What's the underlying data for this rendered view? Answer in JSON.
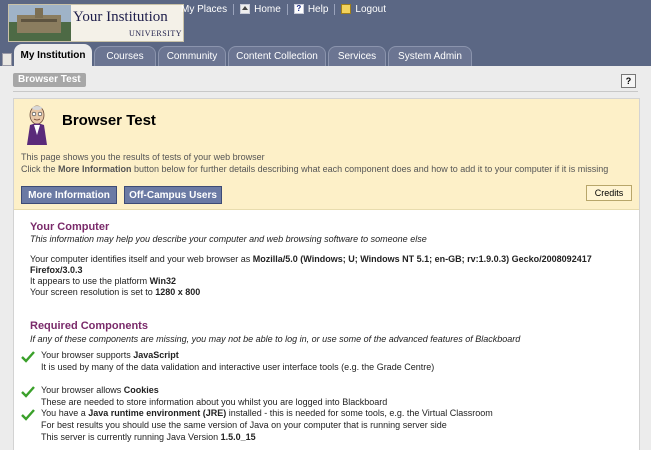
{
  "banner": {
    "institution_name": "Your Institution",
    "institution_sub": "UNIVERSITY"
  },
  "topnav": {
    "my_places": "My Places",
    "home": "Home",
    "help": "Help",
    "logout": "Logout"
  },
  "tabs": [
    {
      "label": "My Institution",
      "active": true
    },
    {
      "label": "Courses",
      "active": false
    },
    {
      "label": "Community",
      "active": false
    },
    {
      "label": "Content Collection",
      "active": false
    },
    {
      "label": "Services",
      "active": false
    },
    {
      "label": "System Admin",
      "active": false
    }
  ],
  "breadcrumb": "Browser Test",
  "help_button": "?",
  "intro": {
    "title": "Browser Test",
    "desc_line1": "This page shows you the results of tests of your web browser",
    "desc_line2_pre": "Click the ",
    "desc_line2_bold": "More Information",
    "desc_line2_post": " button below for further details describing what each component does and how to add it to your computer if it is missing",
    "btn_more": "More Information",
    "btn_offcampus": "Off-Campus Users",
    "btn_credits": "Credits"
  },
  "computer": {
    "title": "Your Computer",
    "note": "This information may help you describe your computer and web browsing software to someone else",
    "identify_pre": "Your computer identifies itself and your web browser as ",
    "user_agent": "Mozilla/5.0 (Windows; U; Windows NT 5.1; en-GB; rv:1.9.0.3) Gecko/2008092417 Firefox/3.0.3",
    "platform_pre": "It appears to use the platform ",
    "platform": "Win32",
    "resolution_pre": "Your screen resolution is set to ",
    "resolution": "1280 x 800"
  },
  "required": {
    "title": "Required Components",
    "note": "If any of these components are missing, you may not be able to log in, or use some of the advanced features of Blackboard",
    "items": [
      {
        "pre": "Your browser supports ",
        "name": "JavaScript",
        "post": "",
        "detail": "It is used by many of the data validation and interactive user interface tools (e.g. the Grade Centre)"
      },
      {
        "pre": "Your browser allows ",
        "name": "Cookies",
        "post": "",
        "detail": "These are needed to store information about you whilst you are logged into Blackboard"
      },
      {
        "pre": "You have a ",
        "name": "Java runtime environment (JRE)",
        "post": " installed - this is needed for some tools, e.g. the Virtual Classroom",
        "detail": "For best results you should use the same version of Java on your computer that is running server side",
        "detail2_pre": "This server is currently running Java Version ",
        "detail2_val": "1.5.0_15"
      }
    ]
  },
  "colors": {
    "banner_bg": "#5b6784",
    "intro_bg": "#fdf0c8",
    "section_title": "#7a2a6a",
    "button_bg": "#6b7aa4",
    "check_green": "#3aa02a"
  }
}
